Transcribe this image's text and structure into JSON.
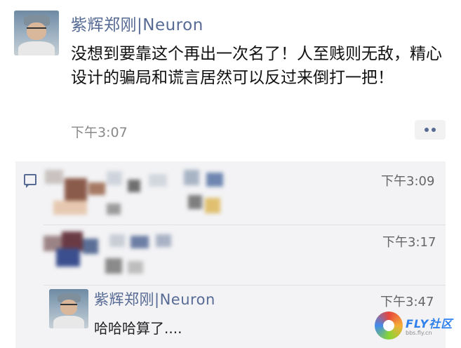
{
  "post": {
    "author": "紫辉郑刚|Neuron",
    "text": "没想到要靠这个再出一次名了！人至贱则无敌，精心设计的骗局和谎言居然可以反过来倒打一把！",
    "time": "下午3:07",
    "more_icon": "ellipsis-icon"
  },
  "comments": {
    "icon": "comment-icon",
    "items": [
      {
        "author": "",
        "text": "",
        "time": "下午3:09"
      },
      {
        "author": "",
        "text": "",
        "time": "下午3:17"
      },
      {
        "author": "紫辉郑刚|Neuron",
        "text": "哈哈哈算了....",
        "time": "下午3:47"
      }
    ]
  },
  "watermark": {
    "brand": "FLY社区",
    "url": "bbs.fly.cn"
  },
  "colors": {
    "author_link": "#576b95",
    "comment_bg": "#f3f3f5",
    "time_text": "#888888"
  }
}
